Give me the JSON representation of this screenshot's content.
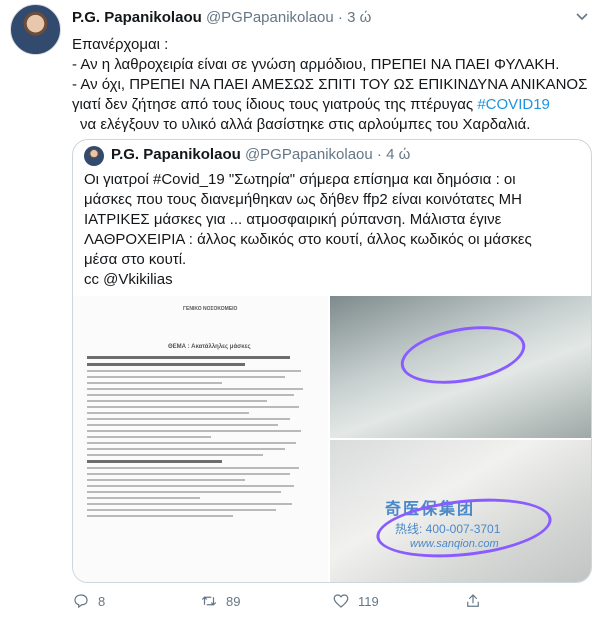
{
  "tweet": {
    "name": "P.G. Papanikolaou",
    "handle": "@PGPapanikolaou",
    "separator": "·",
    "time": "3 ώ",
    "lines": [
      "Επανέρχομαι :",
      "- Αν η λαθροχειρία είναι σε γνώση αρμόδιου, ΠΡΕΠΕΙ ΝΑ ΠΑΕΙ ΦΥΛΑΚΗ.",
      "- Αν όχι, ΠΡΕΠΕΙ ΝΑ ΠΑΕΙ ΑΜΕΣΩΣ ΣΠΙΤΙ ΤΟΥ ΩΣ ΕΠΙΚΙΝΔΥΝΑ ΑΝΙΚΑΝΟΣ"
    ],
    "line4_pre": "γιατί δεν ζήτησε από τους ίδιους τους γιατρούς της πτέρυγας ",
    "hashtag": "#COVID19",
    "line5": "να ελέγξουν το υλικό αλλά βασίστηκε στις αρλούμπες του Χαρδαλιά."
  },
  "quote": {
    "name": "P.G. Papanikolaou",
    "handle": "@PGPapanikolaou",
    "separator": "·",
    "time": "4 ώ",
    "lines": [
      "Οι γιατροί #Covid_19 \"Σωτηρία\" σήμερα επίσημα και δημόσια : οι",
      "μάσκες που τους διανεμήθηκαν ως δήθεν ffp2 είναι κοινότατες ΜΗ",
      "ΙΑΤΡΙΚΕΣ μάσκες για ... ατμοσφαιρική ρύπανση. Μάλιστα έγινε",
      "ΛΑΘΡΟΧΕΙΡΙΑ : άλλος κωδικός στο κουτί, άλλος κωδικός οι μάσκες",
      "μέσα στο κουτί.",
      "cc @Vkikilias"
    ],
    "doc": {
      "hospital": "ΓΕΝΙΚΟ ΝΟΣΟΚΟΜΕΙΟ",
      "subject": "ΘΕΜΑ : Ακατάλληλες μάσκες"
    },
    "photo2": {
      "chinese": "奇医保集团",
      "tel": "热线: 400-007-3701",
      "web": "www.sanqion.com"
    }
  },
  "actions": {
    "replies": "8",
    "retweets": "89",
    "likes": "119"
  },
  "colors": {
    "link": "#1b95e0",
    "secondary": "#657786",
    "border": "#ccd6dd",
    "highlight": "#8a5cff"
  }
}
